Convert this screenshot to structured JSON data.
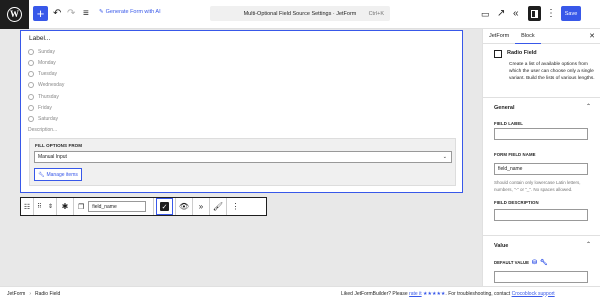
{
  "topbar": {
    "generate_label": "Generate Form with AI",
    "doc_title": "Multi-Optional Field Source Settings · JetForm",
    "shortcut": "Ctrl+K",
    "save_label": "Save"
  },
  "block": {
    "label": "Label...",
    "options": [
      "Sunday",
      "Monday",
      "Tuesday",
      "Wednesday",
      "Thursday",
      "Friday",
      "Saturday"
    ],
    "description": "Description...",
    "fill_label": "FILL OPTIONS FROM",
    "fill_value": "Manual Input",
    "manage_label": "Manage items"
  },
  "toolbar": {
    "field_name": "field_name"
  },
  "statusbar": {
    "crumb1": "JetForm",
    "crumb2": "Radio Field",
    "note_prefix": "Liked JetFormBuilder? Please",
    "note_link": "rate it",
    "note_stars": "★★★★★",
    "note_suffix": ". For troubleshooting, contact",
    "note_support": "Crocoblock support"
  },
  "sidebar": {
    "tab1": "JetForm",
    "tab2": "Block",
    "block_name": "Radio Field",
    "block_desc": "Create a list of available options from which the user can choose only a single variant. Build the lists of various lengths.",
    "general_title": "General",
    "field_label_title": "FIELD LABEL",
    "field_label_value": "",
    "form_field_name_title": "FORM FIELD NAME",
    "form_field_name_value": "field_name",
    "name_hint": "Should contain only lowercase Latin letters, numbers, \"-\" or \"_\". No spaces allowed.",
    "field_desc_title": "FIELD DESCRIPTION",
    "field_desc_value": "",
    "value_title": "Value",
    "default_value_title": "DEFAULT VALUE"
  }
}
